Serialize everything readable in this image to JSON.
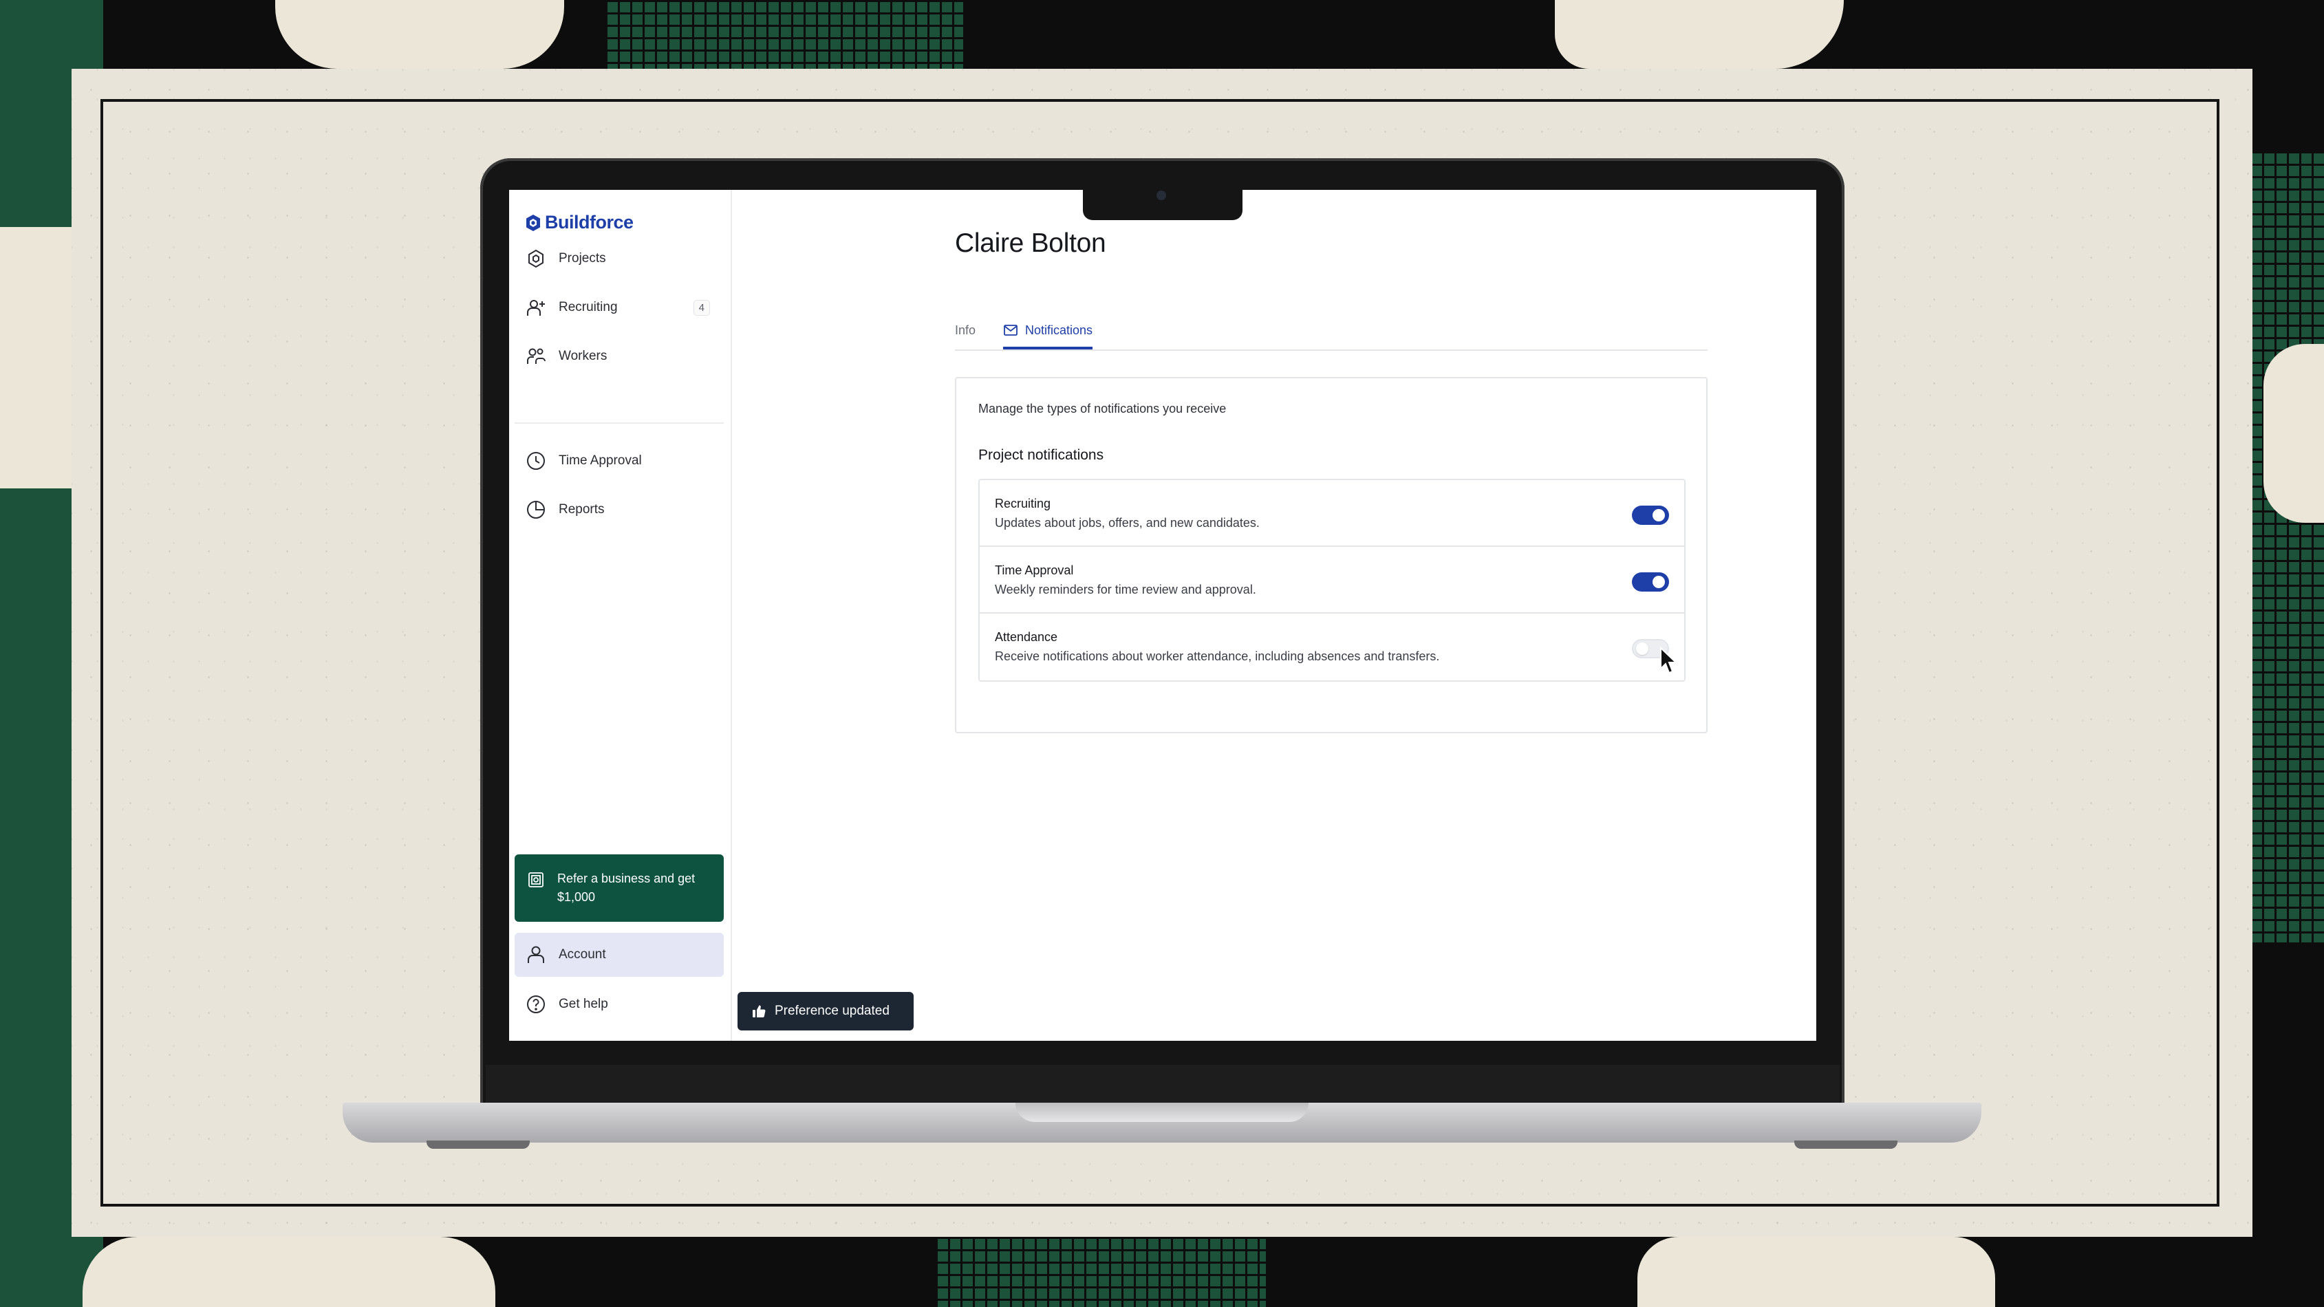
{
  "app": {
    "brand": "Buildforce",
    "accent_color": "#1e3fa8",
    "refer_color": "#0e5340"
  },
  "sidebar": {
    "items": [
      {
        "label": "Projects",
        "icon": "hexagon-icon"
      },
      {
        "label": "Recruiting",
        "icon": "user-plus-icon",
        "badge": "4"
      },
      {
        "label": "Workers",
        "icon": "users-icon"
      },
      {
        "label": "Time Approval",
        "icon": "clock-icon"
      },
      {
        "label": "Reports",
        "icon": "pie-chart-icon"
      }
    ],
    "refer": {
      "label": "Refer a business and get $1,000",
      "icon": "gift-icon"
    },
    "account": {
      "label": "Account",
      "icon": "user-icon",
      "active": true
    },
    "help": {
      "label": "Get help",
      "icon": "help-circle-icon"
    }
  },
  "main": {
    "title": "Claire Bolton",
    "tabs": [
      {
        "label": "Info",
        "active": false
      },
      {
        "label": "Notifications",
        "icon": "mail-icon",
        "active": true
      }
    ],
    "card": {
      "description": "Manage the types of notifications you receive",
      "section_title": "Project notifications",
      "preferences": [
        {
          "title": "Recruiting",
          "subtitle": "Updates about jobs, offers, and new candidates.",
          "enabled": true
        },
        {
          "title": "Time Approval",
          "subtitle": "Weekly reminders for time review and approval.",
          "enabled": true
        },
        {
          "title": "Attendance",
          "subtitle": "Receive notifications about worker attendance, including absences and transfers.",
          "enabled": false
        }
      ]
    }
  },
  "toast": {
    "label": "Preference updated",
    "icon": "thumbs-up-icon"
  }
}
